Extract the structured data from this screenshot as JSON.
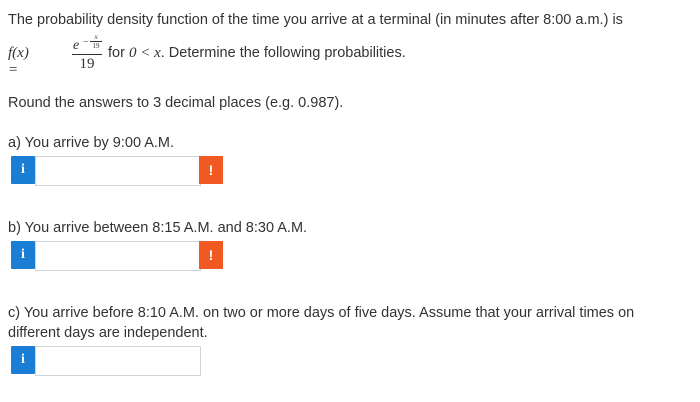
{
  "intro": "The probability density function of the time you arrive at a terminal (in minutes after 8:00 a.m.) is",
  "formula": {
    "lhs": "f(x) =",
    "numerator_base": "e",
    "exponent_sign": "−",
    "exponent_num": "x",
    "exponent_den": "19",
    "denominator": "19",
    "condition_pre": "for",
    "condition_math": "0 < x",
    "condition_post": ". Determine the following probabilities."
  },
  "rounding": "Round the answers to 3 decimal places (e.g. 0.987).",
  "questions": [
    {
      "label": "a) You arrive by 9:00 A.M.",
      "info_icon": "i",
      "warn_icon": "!",
      "value": ""
    },
    {
      "label": "b) You arrive between 8:15 A.M. and 8:30 A.M.",
      "info_icon": "i",
      "warn_icon": "!",
      "value": ""
    },
    {
      "label_line1": "c) You arrive before 8:10 A.M. on two or more days of five days. Assume that your arrival times on",
      "label_line2": "different days are independent.",
      "info_icon": "i",
      "value": ""
    }
  ],
  "colors": {
    "info": "#1a7ed4",
    "warning": "#f05a22",
    "text": "#333333"
  }
}
